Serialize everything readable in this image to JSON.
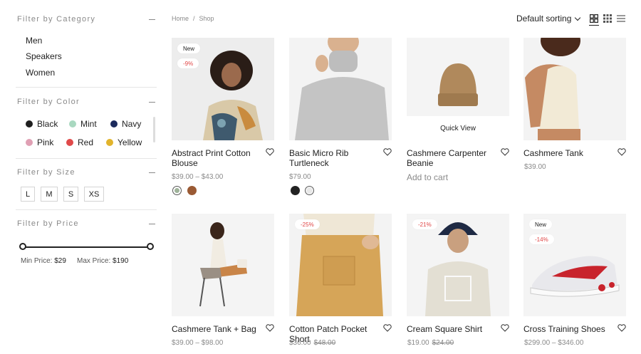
{
  "sidebar": {
    "category": {
      "title": "Filter by Category",
      "items": [
        "Men",
        "Speakers",
        "Women"
      ]
    },
    "color": {
      "title": "Filter by Color",
      "items": [
        {
          "label": "Black",
          "color": "#1f1f1f"
        },
        {
          "label": "Mint",
          "color": "#a9d8c0"
        },
        {
          "label": "Navy",
          "color": "#1c2a5c"
        },
        {
          "label": "Pink",
          "color": "#e0a0b4"
        },
        {
          "label": "Red",
          "color": "#e04a4a"
        },
        {
          "label": "Yellow",
          "color": "#e2b42c"
        }
      ]
    },
    "size": {
      "title": "Filter by Size",
      "items": [
        "L",
        "M",
        "S",
        "XS"
      ]
    },
    "price": {
      "title": "Filter by Price",
      "min_label": "Min Price:",
      "min_value": "$29",
      "max_label": "Max Price:",
      "max_value": "$190"
    }
  },
  "breadcrumb": {
    "home": "Home",
    "sep": "/",
    "current": "Shop"
  },
  "toolbar": {
    "sorting": "Default sorting",
    "views": [
      {
        "icon": "grid-2-icon",
        "active": true
      },
      {
        "icon": "grid-3-icon",
        "active": false
      },
      {
        "icon": "list-icon",
        "active": false
      }
    ]
  },
  "products": [
    {
      "name": "Abstract Print Cotton Blouse",
      "price": "$39.00 – $43.00",
      "badge_new": "New",
      "badge_sale": "-9%",
      "swatches": [
        "#9fb39a",
        "#9a5a34"
      ]
    },
    {
      "name": "Basic Micro Rib Turtleneck",
      "price": "$79.00",
      "swatches": [
        "#222222",
        "#e8e8e8"
      ]
    },
    {
      "name": "Cashmere Carpenter Beanie",
      "cart": "Add to cart",
      "quick_view": "Quick View"
    },
    {
      "name": "Cashmere Tank",
      "price": "$39.00"
    },
    {
      "name": "Cashmere Tank + Bag",
      "price": "$39.00 – $98.00"
    },
    {
      "name": "Cotton Patch Pocket Short",
      "badge_sale": "-25%",
      "price_new": "$36.00",
      "price_old": "$48.00"
    },
    {
      "name": "Cream Square Shirt",
      "badge_sale": "-21%",
      "price_new": "$19.00",
      "price_old": "$24.00"
    },
    {
      "name": "Cross Training Shoes",
      "badge_new": "New",
      "badge_sale": "-14%",
      "price": "$299.00 – $346.00"
    }
  ]
}
